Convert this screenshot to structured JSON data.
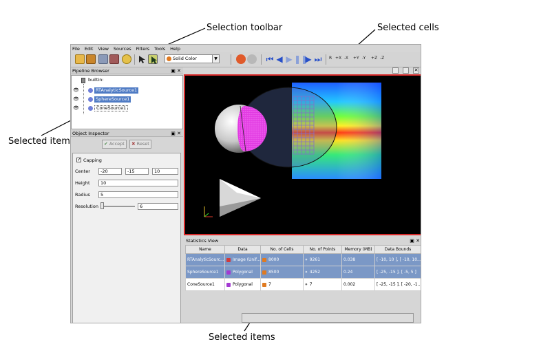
{
  "annotations": {
    "selection_toolbar": "Selection toolbar",
    "selected_cells": "Selected cells",
    "selected_items_left": "Selected items",
    "selected_items_bottom": "Selected items"
  },
  "menubar": [
    "File",
    "Edit",
    "View",
    "Sources",
    "Filters",
    "Tools",
    "Help"
  ],
  "toolbar": {
    "color_mode": "Solid Color",
    "axis_buttons": [
      "+X",
      "-X",
      "+Y",
      "-Y",
      "+Z",
      "-Z"
    ],
    "reset_label": "R"
  },
  "pipeline_browser": {
    "title": "Pipeline Browser",
    "root": "builtin:",
    "items": [
      {
        "label": "RTAnalyticSource1",
        "selected": true
      },
      {
        "label": "SphereSource1",
        "selected": true
      },
      {
        "label": "ConeSource1",
        "selected": false
      }
    ]
  },
  "object_inspector": {
    "title": "Object Inspector",
    "accept": "Accept",
    "reset": "Reset",
    "capping_label": "Capping",
    "capping_checked": true,
    "center_label": "Center",
    "center": [
      "-20",
      "-15",
      "10"
    ],
    "height_label": "Height",
    "height": "10",
    "radius_label": "Radius",
    "radius": "5",
    "resolution_label": "Resolution",
    "resolution": "6"
  },
  "statistics": {
    "title": "Statistics View",
    "columns": [
      "Name",
      "Data",
      "No. of Cells",
      "No. of Points",
      "Memory (MB)",
      "Data Bounds"
    ],
    "rows": [
      {
        "name": "RTAnalyticSourc...",
        "data": "Image (Unif...",
        "cells": "8000",
        "points": "9261",
        "memory": "0.038",
        "bounds": "[ -10, 10 ], [ -10, 10...",
        "selected": true
      },
      {
        "name": "SphereSource1",
        "data": "Polygonal",
        "cells": "8500",
        "points": "4252",
        "memory": "0.24",
        "bounds": "[ -25, -15 ], [ -5, 5 ]",
        "selected": true
      },
      {
        "name": "ConeSource1",
        "data": "Polygonal",
        "cells": "7",
        "points": "7",
        "memory": "0.002",
        "bounds": "[ -25, -15 ], [ -20, -1...",
        "selected": false
      }
    ]
  },
  "colors": {
    "selection_highlight": "#4f7bc4",
    "table_selection": "#7b98c6",
    "view_border": "#d92a2a",
    "selected_cells_magenta": "#e23be2"
  }
}
